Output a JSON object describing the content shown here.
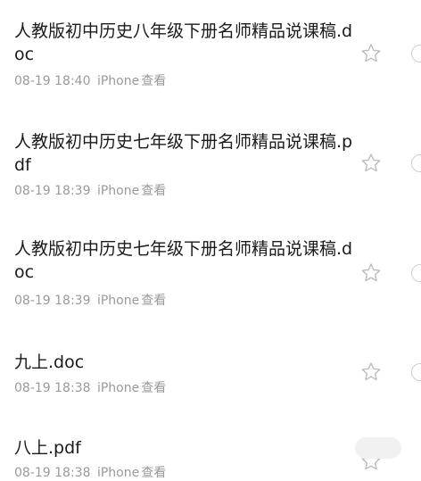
{
  "files": [
    {
      "name": "人教版初中历史八年级下册名师精品说课稿.doc",
      "time": "08-19 18:40",
      "source": "iPhone",
      "action": "查看",
      "starred": false
    },
    {
      "name": "人教版初中历史七年级下册名师精品说课稿.pdf",
      "time": "08-19 18:39",
      "source": "iPhone",
      "action": "查看",
      "starred": false
    },
    {
      "name": "人教版初中历史七年级下册名师精品说课稿.doc",
      "time": "08-19 18:39",
      "source": "iPhone",
      "action": "查看",
      "starred": false
    },
    {
      "name": "九上.doc",
      "time": "08-19 18:38",
      "source": "iPhone",
      "action": "查看",
      "starred": false
    },
    {
      "name": "八上.pdf",
      "time": "08-19 18:38",
      "source": "iPhone",
      "action": "查看",
      "starred": false
    }
  ],
  "icons": {
    "favorite": "star-outline-icon",
    "select": "circle-outline-icon"
  },
  "colors": {
    "title": "#1a1a1a",
    "meta": "#9a9a9a",
    "icon": "#bdbdbd",
    "background": "#ffffff"
  }
}
